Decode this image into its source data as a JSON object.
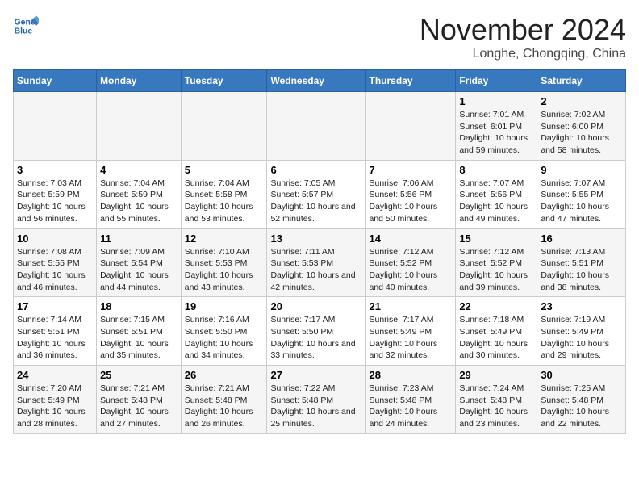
{
  "header": {
    "logo_line1": "General",
    "logo_line2": "Blue",
    "month": "November 2024",
    "location": "Longhe, Chongqing, China"
  },
  "weekdays": [
    "Sunday",
    "Monday",
    "Tuesday",
    "Wednesday",
    "Thursday",
    "Friday",
    "Saturday"
  ],
  "weeks": [
    [
      {
        "day": "",
        "info": ""
      },
      {
        "day": "",
        "info": ""
      },
      {
        "day": "",
        "info": ""
      },
      {
        "day": "",
        "info": ""
      },
      {
        "day": "",
        "info": ""
      },
      {
        "day": "1",
        "info": "Sunrise: 7:01 AM\nSunset: 6:01 PM\nDaylight: 10 hours\nand 59 minutes."
      },
      {
        "day": "2",
        "info": "Sunrise: 7:02 AM\nSunset: 6:00 PM\nDaylight: 10 hours\nand 58 minutes."
      }
    ],
    [
      {
        "day": "3",
        "info": "Sunrise: 7:03 AM\nSunset: 5:59 PM\nDaylight: 10 hours\nand 56 minutes."
      },
      {
        "day": "4",
        "info": "Sunrise: 7:04 AM\nSunset: 5:59 PM\nDaylight: 10 hours\nand 55 minutes."
      },
      {
        "day": "5",
        "info": "Sunrise: 7:04 AM\nSunset: 5:58 PM\nDaylight: 10 hours\nand 53 minutes."
      },
      {
        "day": "6",
        "info": "Sunrise: 7:05 AM\nSunset: 5:57 PM\nDaylight: 10 hours\nand 52 minutes."
      },
      {
        "day": "7",
        "info": "Sunrise: 7:06 AM\nSunset: 5:56 PM\nDaylight: 10 hours\nand 50 minutes."
      },
      {
        "day": "8",
        "info": "Sunrise: 7:07 AM\nSunset: 5:56 PM\nDaylight: 10 hours\nand 49 minutes."
      },
      {
        "day": "9",
        "info": "Sunrise: 7:07 AM\nSunset: 5:55 PM\nDaylight: 10 hours\nand 47 minutes."
      }
    ],
    [
      {
        "day": "10",
        "info": "Sunrise: 7:08 AM\nSunset: 5:55 PM\nDaylight: 10 hours\nand 46 minutes."
      },
      {
        "day": "11",
        "info": "Sunrise: 7:09 AM\nSunset: 5:54 PM\nDaylight: 10 hours\nand 44 minutes."
      },
      {
        "day": "12",
        "info": "Sunrise: 7:10 AM\nSunset: 5:53 PM\nDaylight: 10 hours\nand 43 minutes."
      },
      {
        "day": "13",
        "info": "Sunrise: 7:11 AM\nSunset: 5:53 PM\nDaylight: 10 hours\nand 42 minutes."
      },
      {
        "day": "14",
        "info": "Sunrise: 7:12 AM\nSunset: 5:52 PM\nDaylight: 10 hours\nand 40 minutes."
      },
      {
        "day": "15",
        "info": "Sunrise: 7:12 AM\nSunset: 5:52 PM\nDaylight: 10 hours\nand 39 minutes."
      },
      {
        "day": "16",
        "info": "Sunrise: 7:13 AM\nSunset: 5:51 PM\nDaylight: 10 hours\nand 38 minutes."
      }
    ],
    [
      {
        "day": "17",
        "info": "Sunrise: 7:14 AM\nSunset: 5:51 PM\nDaylight: 10 hours\nand 36 minutes."
      },
      {
        "day": "18",
        "info": "Sunrise: 7:15 AM\nSunset: 5:51 PM\nDaylight: 10 hours\nand 35 minutes."
      },
      {
        "day": "19",
        "info": "Sunrise: 7:16 AM\nSunset: 5:50 PM\nDaylight: 10 hours\nand 34 minutes."
      },
      {
        "day": "20",
        "info": "Sunrise: 7:17 AM\nSunset: 5:50 PM\nDaylight: 10 hours\nand 33 minutes."
      },
      {
        "day": "21",
        "info": "Sunrise: 7:17 AM\nSunset: 5:49 PM\nDaylight: 10 hours\nand 32 minutes."
      },
      {
        "day": "22",
        "info": "Sunrise: 7:18 AM\nSunset: 5:49 PM\nDaylight: 10 hours\nand 30 minutes."
      },
      {
        "day": "23",
        "info": "Sunrise: 7:19 AM\nSunset: 5:49 PM\nDaylight: 10 hours\nand 29 minutes."
      }
    ],
    [
      {
        "day": "24",
        "info": "Sunrise: 7:20 AM\nSunset: 5:49 PM\nDaylight: 10 hours\nand 28 minutes."
      },
      {
        "day": "25",
        "info": "Sunrise: 7:21 AM\nSunset: 5:48 PM\nDaylight: 10 hours\nand 27 minutes."
      },
      {
        "day": "26",
        "info": "Sunrise: 7:21 AM\nSunset: 5:48 PM\nDaylight: 10 hours\nand 26 minutes."
      },
      {
        "day": "27",
        "info": "Sunrise: 7:22 AM\nSunset: 5:48 PM\nDaylight: 10 hours\nand 25 minutes."
      },
      {
        "day": "28",
        "info": "Sunrise: 7:23 AM\nSunset: 5:48 PM\nDaylight: 10 hours\nand 24 minutes."
      },
      {
        "day": "29",
        "info": "Sunrise: 7:24 AM\nSunset: 5:48 PM\nDaylight: 10 hours\nand 23 minutes."
      },
      {
        "day": "30",
        "info": "Sunrise: 7:25 AM\nSunset: 5:48 PM\nDaylight: 10 hours\nand 22 minutes."
      }
    ]
  ]
}
